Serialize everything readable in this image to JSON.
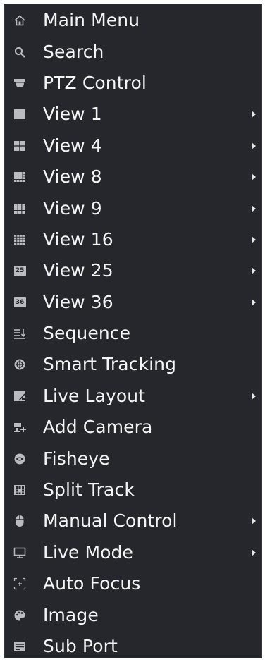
{
  "menu": {
    "items": [
      {
        "label": "Main Menu",
        "icon": "home-icon",
        "submenu": false
      },
      {
        "label": "Search",
        "icon": "search-icon",
        "submenu": false
      },
      {
        "label": "PTZ Control",
        "icon": "dome-camera-icon",
        "submenu": false
      },
      {
        "label": "View 1",
        "icon": "view-1-icon",
        "submenu": true
      },
      {
        "label": "View 4",
        "icon": "view-4-icon",
        "submenu": true
      },
      {
        "label": "View 8",
        "icon": "view-8-icon",
        "submenu": true
      },
      {
        "label": "View 9",
        "icon": "view-9-icon",
        "submenu": true
      },
      {
        "label": "View 16",
        "icon": "view-16-icon",
        "submenu": true
      },
      {
        "label": "View 25",
        "icon": "view-25-icon",
        "icon_text": "25",
        "submenu": true
      },
      {
        "label": "View 36",
        "icon": "view-36-icon",
        "icon_text": "36",
        "submenu": true
      },
      {
        "label": "Sequence",
        "icon": "sequence-icon",
        "submenu": false
      },
      {
        "label": "Smart Tracking",
        "icon": "smart-tracking-icon",
        "submenu": false
      },
      {
        "label": "Live Layout",
        "icon": "live-layout-icon",
        "submenu": true
      },
      {
        "label": "Add Camera",
        "icon": "add-camera-icon",
        "submenu": false
      },
      {
        "label": "Fisheye",
        "icon": "fisheye-icon",
        "submenu": false
      },
      {
        "label": "Split Track",
        "icon": "split-track-icon",
        "submenu": false
      },
      {
        "label": "Manual Control",
        "icon": "mouse-icon",
        "submenu": true
      },
      {
        "label": "Live Mode",
        "icon": "monitor-icon",
        "submenu": true
      },
      {
        "label": "Auto Focus",
        "icon": "auto-focus-icon",
        "submenu": false
      },
      {
        "label": "Image",
        "icon": "image-palette-icon",
        "submenu": false
      },
      {
        "label": "Sub Port",
        "icon": "sub-port-icon",
        "submenu": false
      }
    ]
  },
  "colors": {
    "background": "#25272d",
    "text": "#f4f4f4",
    "icon": "#b9bbc0"
  }
}
